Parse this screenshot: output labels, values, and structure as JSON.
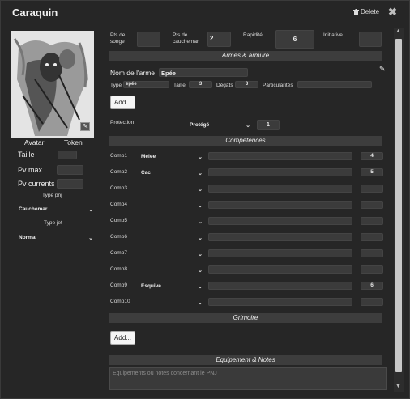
{
  "window": {
    "title": "Caraquin",
    "delete_label": "Delete"
  },
  "left": {
    "avatar_label": "Avatar",
    "token_label": "Token",
    "taille_label": "Taille",
    "pvmax_label": "Pv max",
    "pvcur_label": "Pv currents",
    "typepnj_label": "Type pnj",
    "typepnj_value": "Cauchemar",
    "typejet_label": "Type jet",
    "typejet_value": "Normal"
  },
  "stats": {
    "songe_label": "Pts de songe",
    "songe_value": "",
    "cauchemar_label": "Pts de cauchemar",
    "cauchemar_value": "2",
    "rapidite_label": "Rapidité",
    "rapidite_value": "6",
    "initiative_label": "Initiative",
    "initiative_value": ""
  },
  "armes": {
    "header": "Armes & armure",
    "nom_label": "Nom de l'arme",
    "nom_value": "Epée",
    "type_label": "Type",
    "type_value": "epée",
    "taille_label": "Taille",
    "taille_value": "3",
    "degats_label": "Dégâts",
    "degats_value": "3",
    "partic_label": "Particularités",
    "partic_value": "",
    "add_label": "Add...",
    "protection_label": "Protection",
    "protection_select": "Protégé",
    "protection_value": "1"
  },
  "competences": {
    "header": "Compétences",
    "rows": [
      {
        "label": "Comp1",
        "select": "Melee",
        "value": "4"
      },
      {
        "label": "Comp2",
        "select": "Cac",
        "value": "5"
      },
      {
        "label": "Comp3",
        "select": "",
        "value": ""
      },
      {
        "label": "Comp4",
        "select": "",
        "value": ""
      },
      {
        "label": "Comp5",
        "select": "",
        "value": ""
      },
      {
        "label": "Comp6",
        "select": "",
        "value": ""
      },
      {
        "label": "Comp7",
        "select": "",
        "value": ""
      },
      {
        "label": "Comp8",
        "select": "",
        "value": ""
      },
      {
        "label": "Comp9",
        "select": "Esquive",
        "value": "6"
      },
      {
        "label": "Comp10",
        "select": "",
        "value": ""
      }
    ]
  },
  "grimoire": {
    "header": "Grimoire",
    "add_label": "Add..."
  },
  "equipement": {
    "header": "Equipement & Notes",
    "placeholder": "Equipements ou notes concernant le PNJ"
  },
  "icons": {
    "trash": "trash-icon",
    "close": "close-icon",
    "edit": "pencil-icon",
    "chevron": "chevron-down-icon"
  }
}
